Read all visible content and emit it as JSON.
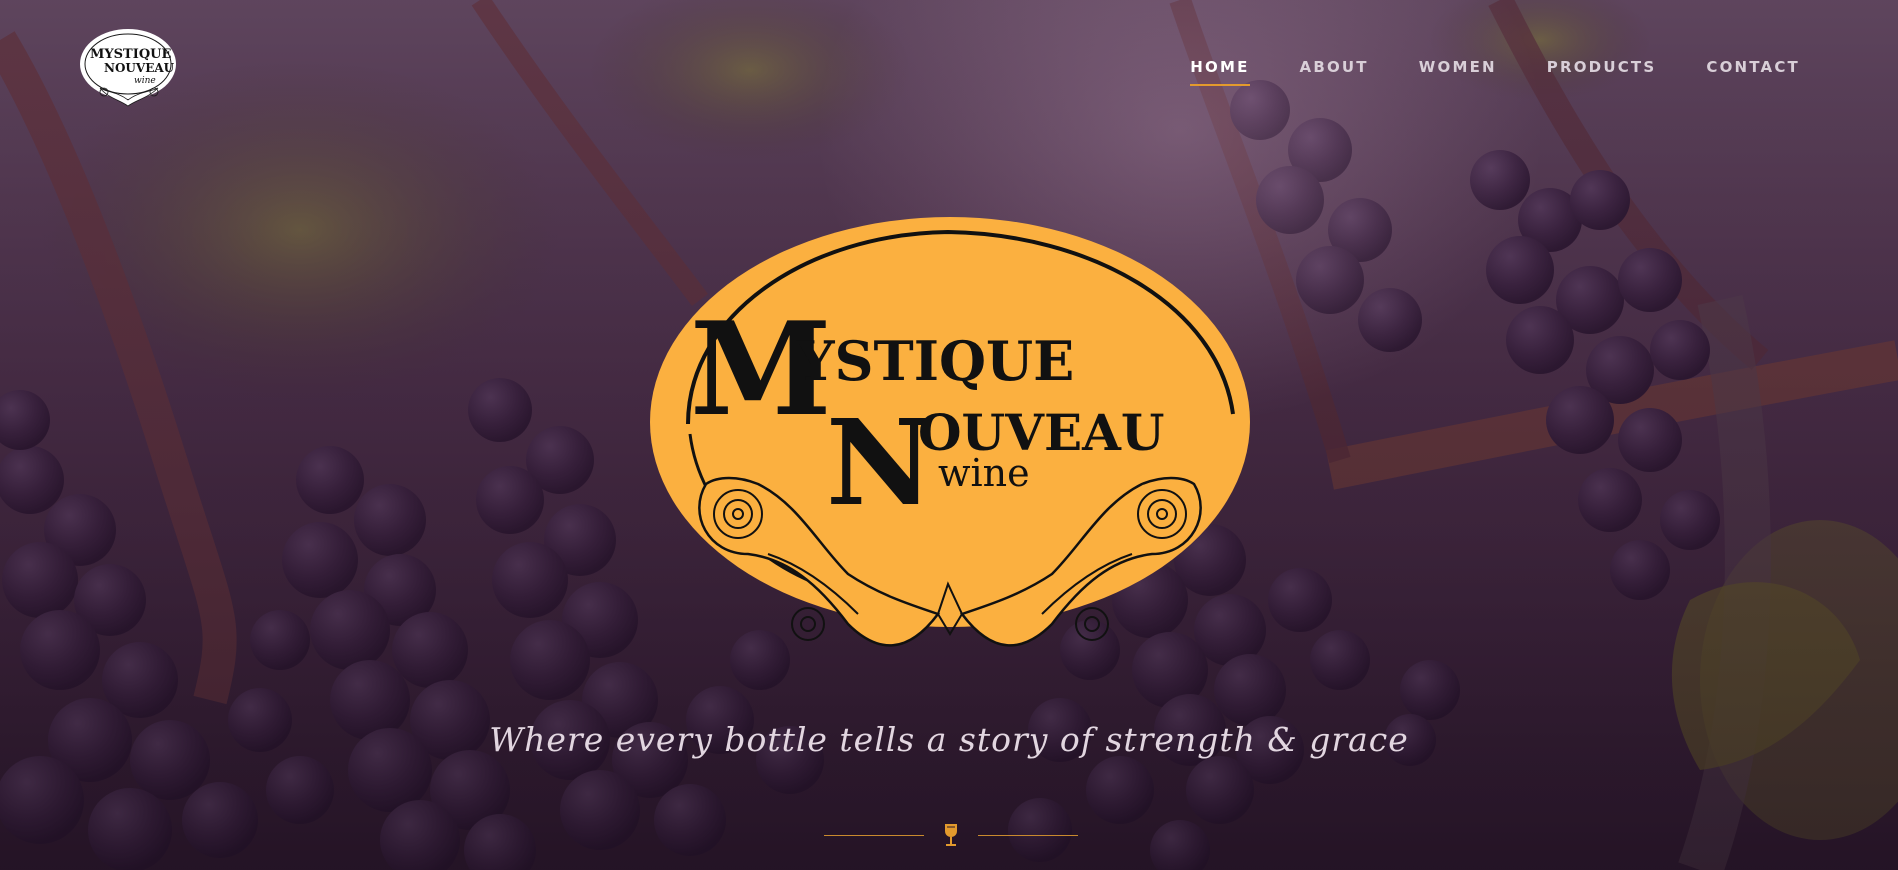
{
  "site": {
    "logo_alt": "Mystique Nouveau wine",
    "logo_text": {
      "line1": "MYSTIQUE",
      "line2": "NOUVEAU",
      "line3": "wine"
    }
  },
  "nav": {
    "items": [
      {
        "label": "HOME",
        "active": true
      },
      {
        "label": "ABOUT",
        "active": false
      },
      {
        "label": "WOMEN",
        "active": false
      },
      {
        "label": "PRODUCTS",
        "active": false
      },
      {
        "label": "CONTACT",
        "active": false
      }
    ]
  },
  "hero": {
    "emblem_text": {
      "line1": "MYSTIQUE",
      "line2": "NOUVEAU",
      "line3": "wine"
    },
    "tagline": "Where every bottle tells a story of strength & grace",
    "divider_icon": "wine-glass-icon"
  },
  "colors": {
    "accent": "#e39a2d",
    "emblem_fill": "#fbb040",
    "nav_text": "#d9cfd8",
    "overlay": "#3a1f3a"
  }
}
